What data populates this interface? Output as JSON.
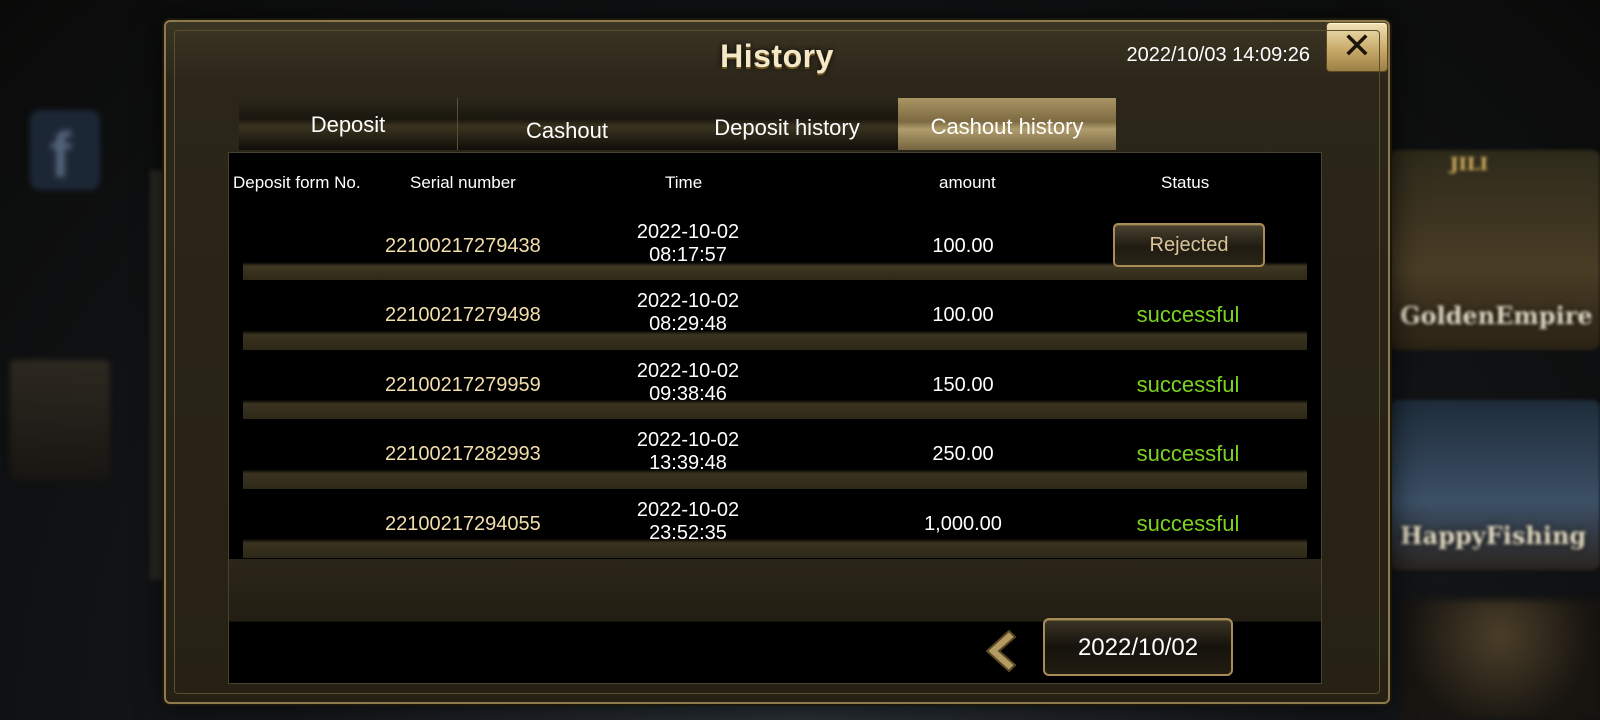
{
  "background": {
    "tiles": [
      {
        "brand": "JILI",
        "label": "GoldenEmpire"
      },
      {
        "label": "HappyFishing"
      }
    ]
  },
  "dialog": {
    "title": "History",
    "datetime": "2022/10/03 14:09:26",
    "close_icon": "close-x-icon",
    "tabs": [
      {
        "label": "Deposit",
        "active": false
      },
      {
        "label": "Cashout",
        "active": false
      },
      {
        "label": "Deposit history",
        "active": false
      },
      {
        "label": "Cashout history",
        "active": true
      }
    ],
    "table": {
      "headers": [
        "Deposit form No.",
        "Serial number",
        "Time",
        "amount",
        "Status"
      ],
      "rows": [
        {
          "serial": "22100217279438",
          "date": "2022-10-02",
          "time": "08:17:57",
          "amount": "100.00",
          "status": "Rejected"
        },
        {
          "serial": "22100217279498",
          "date": "2022-10-02",
          "time": "08:29:48",
          "amount": "100.00",
          "status": "successful"
        },
        {
          "serial": "22100217279959",
          "date": "2022-10-02",
          "time": "09:38:46",
          "amount": "150.00",
          "status": "successful"
        },
        {
          "serial": "22100217282993",
          "date": "2022-10-02",
          "time": "13:39:48",
          "amount": "250.00",
          "status": "successful"
        },
        {
          "serial": "22100217294055",
          "date": "2022-10-02",
          "time": "23:52:35",
          "amount": "1,000.00",
          "status": "successful"
        }
      ]
    },
    "pager": {
      "prev_icon": "chevron-left-icon",
      "date": "2022/10/02"
    }
  },
  "colors": {
    "accent_gold": "#a78c55",
    "success_green": "#7cd221",
    "serial_text": "#f3dfab"
  }
}
